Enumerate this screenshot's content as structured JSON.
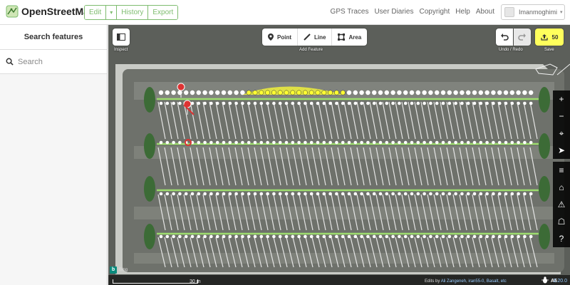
{
  "app": {
    "name": "OpenStreetMap"
  },
  "nav": {
    "edit_label": "Edit",
    "edit_caret": "▾",
    "history_label": "History",
    "export_label": "Export",
    "links": [
      "GPS Traces",
      "User Diaries",
      "Copyright",
      "Help",
      "About"
    ],
    "user_name": "Imanmoghimi",
    "user_caret": "▾"
  },
  "sidebar": {
    "title": "Search features",
    "search_placeholder": "Search"
  },
  "toolbar": {
    "inspect_label": "Inspect",
    "point_label": "Point",
    "line_label": "Line",
    "area_label": "Area",
    "add_feature_label": "Add Feature",
    "undo_redo_label": "Undo / Redo",
    "save_count": "50",
    "save_label": "Save"
  },
  "map_controls": [
    "+",
    "−",
    "⌖",
    "➤",
    "≡",
    "⌂",
    "⚠",
    "☖",
    "?"
  ],
  "footer": {
    "scale_label": "30 m",
    "attrib_prefix": "Edits by",
    "attrib_users": "Ali Zangeneh, iran55-0, Basalt, etc",
    "version": "2.20.0",
    "bing_label": "Bing",
    "issues_text": "A6"
  },
  "colors": {
    "osm_green": "#7ebc6f",
    "save_yellow": "#ffff5c",
    "asphalt": "#5a5d58",
    "selected": "#ffff33",
    "line_green": "#9ddc6e"
  }
}
